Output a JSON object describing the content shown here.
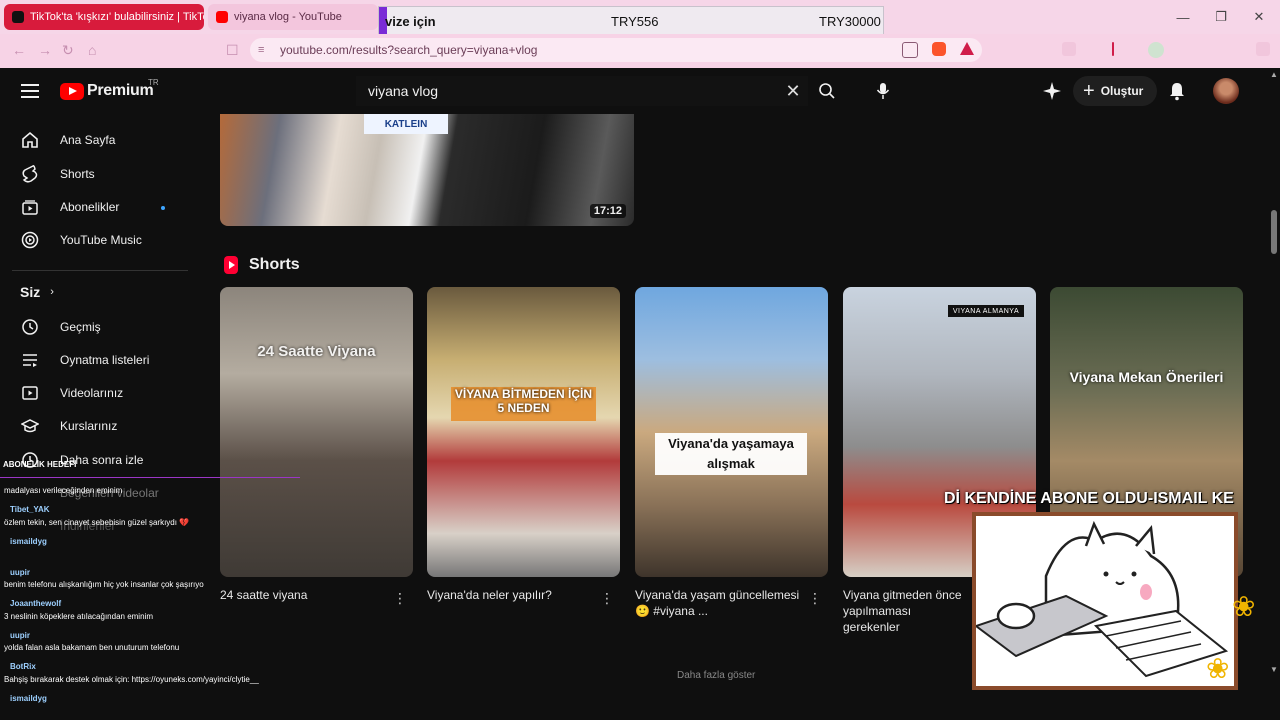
{
  "browser": {
    "tabs": [
      {
        "title": "TikTok'ta 'kışkızı' bulabilirsiniz | TikTok",
        "active": true
      },
      {
        "title": "viyana vlog - YouTube",
        "active": false
      }
    ],
    "url": "youtube.com/results?search_query=viyana+vlog"
  },
  "donation_overlay": {
    "label": "vize için",
    "current": "TRY556",
    "goal": "TRY30000"
  },
  "youtube": {
    "logo_text": "Premium",
    "country_code": "TR",
    "search_query": "viyana vlog",
    "create_label": "Oluştur"
  },
  "sidebar": {
    "items": [
      {
        "label": "Ana Sayfa",
        "icon": "home-icon"
      },
      {
        "label": "Shorts",
        "icon": "shorts-icon"
      },
      {
        "label": "Abonelikler",
        "icon": "subscriptions-icon"
      },
      {
        "label": "YouTube Music",
        "icon": "music-icon"
      }
    ],
    "you_label": "Siz",
    "you_items": [
      {
        "label": "Geçmiş",
        "icon": "history-icon"
      },
      {
        "label": "Oynatma listeleri",
        "icon": "playlists-icon"
      },
      {
        "label": "Videolarınız",
        "icon": "your-videos-icon"
      },
      {
        "label": "Kurslarınız",
        "icon": "courses-icon"
      },
      {
        "label": "Daha sonra izle",
        "icon": "watch-later-icon"
      },
      {
        "label": "Beğenilen videolar",
        "icon": "liked-icon"
      },
      {
        "label": "İndirilenler",
        "icon": "downloads-icon"
      }
    ]
  },
  "main": {
    "video_duration": "17:12",
    "video_thumb_text": "KATLEIN",
    "shorts_label": "Shorts",
    "shorts": [
      {
        "overlay": "24 Saatte Viyana",
        "title": "24 saatte viyana",
        "meta": ""
      },
      {
        "overlay": "VİYANA BİTMEDEN İÇİN 5 NEDEN",
        "title": "Viyana'da neler yapılır?",
        "meta": ""
      },
      {
        "overlay": "Viyana'da yaşamaya alışmak",
        "title": "Viyana'da yaşam güncellemesi 🙂 #viyana ...",
        "meta": ""
      },
      {
        "overlay": "",
        "badge": "VIYANA ALMANYA",
        "title": "Viyana gitmeden önce yapılmaması gerekenler",
        "meta": ""
      },
      {
        "overlay": "Viyana Mekan Önerileri",
        "title": "",
        "meta": ""
      }
    ],
    "bottom_text": "Daha fazla göster"
  },
  "stream_overlay": {
    "goal_label": "ABONELİK HEDEFİ",
    "ticker": "Dİ KENDİNE ABONE OLDU-ISMAIL KE",
    "chat": [
      {
        "user": "",
        "message": "madalyası verileceğinden eminim"
      },
      {
        "user": "Tibet_YAK",
        "message": "özlem tekin, sen cinayet sebebisin güzel şarkıydı 💔"
      },
      {
        "user": "ismaildyg",
        "message": ""
      },
      {
        "user": "uupir",
        "message": "benim telefonu alışkanlığım hiç yok insanlar çok şaşırıyo"
      },
      {
        "user": "Joaanthewolf",
        "message": "3 neslinin köpeklere atılacağından eminim"
      },
      {
        "user": "uupir",
        "message": "yolda falan asla bakamam ben unuturum telefonu"
      },
      {
        "user": "BotRix",
        "message": "Bahşiş bırakarak destek olmak için: https://oyuneks.com/yayinci/clytie__"
      },
      {
        "user": "ismaildyg",
        "message": ""
      }
    ]
  }
}
